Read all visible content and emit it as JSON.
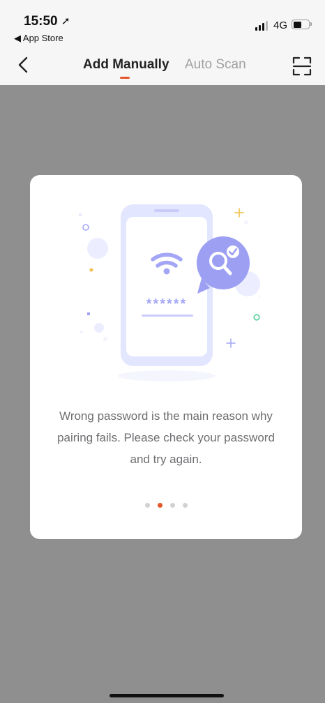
{
  "status_bar": {
    "time": "15:50",
    "back_app": "◀ App Store",
    "network": "4G"
  },
  "nav": {
    "tabs": [
      {
        "label": "Add Manually",
        "active": true
      },
      {
        "label": "Auto Scan",
        "active": false
      }
    ]
  },
  "modal": {
    "message": "Wrong password is the main reason why pairing fails. Please check your password and try again.",
    "password_mask": "******",
    "page_count": 4,
    "active_page": 2
  },
  "colors": {
    "accent": "#e4572a",
    "illustration": "#a3a6f6",
    "overlay": "rgba(0,0,0,0.42)"
  },
  "icons": [
    "location-arrow-icon",
    "signal-icon",
    "battery-icon",
    "chevron-left-icon",
    "scan-frame-icon",
    "wifi-icon",
    "search-check-icon"
  ]
}
